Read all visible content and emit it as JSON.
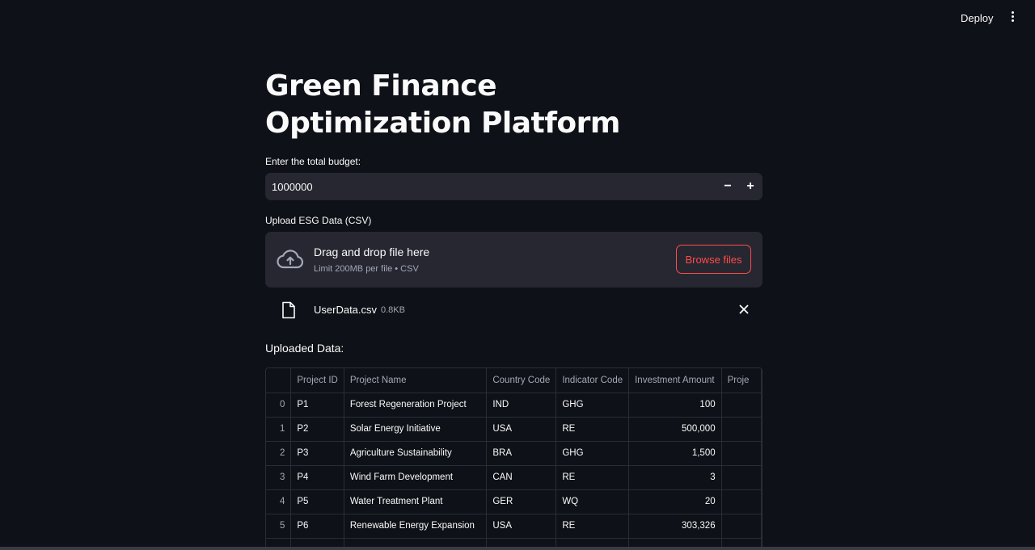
{
  "header": {
    "deploy_label": "Deploy"
  },
  "page": {
    "title": "Green Finance Optimization Platform"
  },
  "budget": {
    "label": "Enter the total budget:",
    "value": "1000000",
    "minus": "−",
    "plus": "+"
  },
  "upload": {
    "label": "Upload ESG Data (CSV)",
    "drop_title": "Drag and drop file here",
    "drop_sub": "Limit 200MB per file • CSV",
    "browse_label": "Browse files",
    "file_name": "UserData.csv",
    "file_size": "0.8KB"
  },
  "data_section": {
    "label": "Uploaded Data:"
  },
  "table": {
    "columns": [
      "",
      "Project ID",
      "Project Name",
      "Country Code",
      "Indicator Code",
      "Investment Amount",
      "Proje"
    ],
    "rows": [
      [
        "0",
        "P1",
        "Forest Regeneration Project",
        "IND",
        "GHG",
        "100",
        ""
      ],
      [
        "1",
        "P2",
        "Solar Energy Initiative",
        "USA",
        "RE",
        "500,000",
        ""
      ],
      [
        "2",
        "P3",
        "Agriculture Sustainability",
        "BRA",
        "GHG",
        "1,500",
        ""
      ],
      [
        "3",
        "P4",
        "Wind Farm Development",
        "CAN",
        "RE",
        "3",
        ""
      ],
      [
        "4",
        "P5",
        "Water Treatment Plant",
        "GER",
        "WQ",
        "20",
        ""
      ],
      [
        "5",
        "P6",
        "Renewable Energy Expansion",
        "USA",
        "RE",
        "303,326",
        ""
      ]
    ]
  },
  "colors": {
    "background": "#0e1117",
    "panel": "#262730",
    "accent": "#ff4b4b",
    "muted": "#a3a8b8"
  },
  "icons": {
    "menu": "kebab-icon",
    "upload": "cloud-upload-icon",
    "file": "file-icon",
    "remove": "close-icon"
  }
}
